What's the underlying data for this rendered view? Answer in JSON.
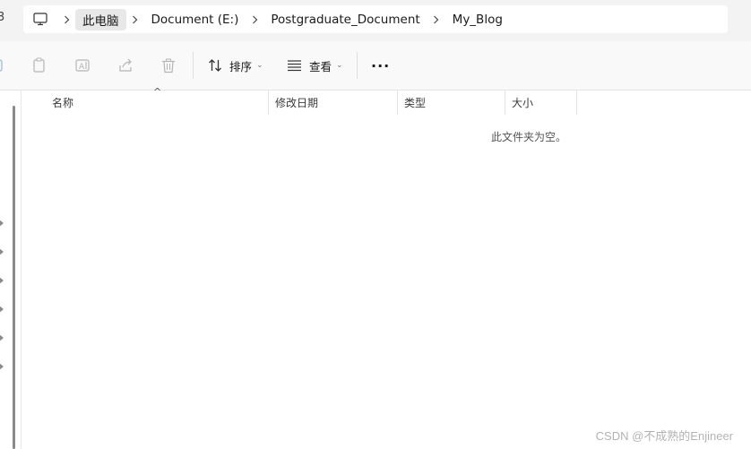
{
  "breadcrumb": {
    "items": [
      "此电脑",
      "Document (E:)",
      "Postgraduate_Document",
      "My_Blog"
    ],
    "separator": "›"
  },
  "toolbar": {
    "sort_label": "排序",
    "view_label": "查看",
    "more_label": "···"
  },
  "columns": {
    "name": "名称",
    "date_modified": "修改日期",
    "type": "类型",
    "size": "大小"
  },
  "content": {
    "empty_message": "此文件夹为空。"
  },
  "watermark": "CSDN @不成熟的Enjineer",
  "icons": {
    "computer": "monitor-icon",
    "copy": "copy-icon",
    "rename": "rename-icon",
    "share": "share-icon",
    "delete": "trash-icon",
    "sort": "sort-arrows-icon",
    "view": "view-lines-icon"
  }
}
